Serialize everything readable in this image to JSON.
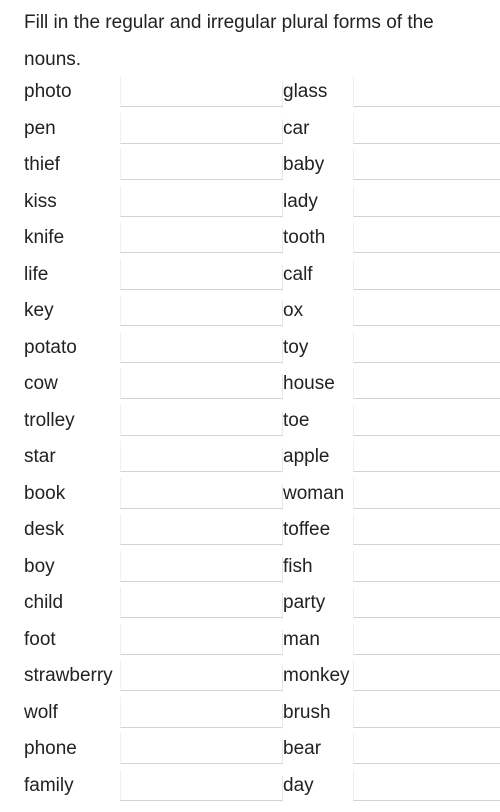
{
  "instructions": "Fill in the regular and irregular plural forms of the nouns.",
  "left_words": [
    "photo",
    "pen",
    "thief",
    "kiss",
    "knife",
    "life",
    "key",
    "potato",
    "cow",
    "trolley",
    "star",
    "book",
    "desk",
    "boy",
    "child",
    "foot",
    "strawberry",
    "wolf",
    "phone",
    "family"
  ],
  "right_words": [
    "glass",
    "car",
    "baby",
    "lady",
    "tooth",
    "calf",
    "ox",
    "toy",
    "house",
    "toe",
    "apple",
    "woman",
    "toffee",
    "fish",
    "party",
    "man",
    "monkey",
    "brush",
    "bear",
    "day"
  ],
  "left_answers": [
    "",
    "",
    "",
    "",
    "",
    "",
    "",
    "",
    "",
    "",
    "",
    "",
    "",
    "",
    "",
    "",
    "",
    "",
    "",
    ""
  ],
  "right_answers": [
    "",
    "",
    "",
    "",
    "",
    "",
    "",
    "",
    "",
    "",
    "",
    "",
    "",
    "",
    "",
    "",
    "",
    "",
    "",
    ""
  ]
}
